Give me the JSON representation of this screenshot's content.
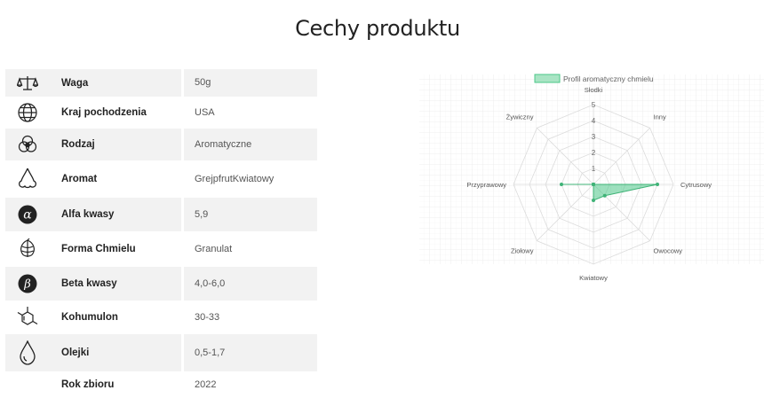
{
  "page": {
    "title": "Cechy produktu"
  },
  "properties": [
    {
      "icon": "scale-icon",
      "label": "Waga",
      "values": [
        "50g"
      ]
    },
    {
      "icon": "globe-icon",
      "label": "Kraj pochodzenia",
      "values": [
        "USA"
      ]
    },
    {
      "icon": "hop-flower-icon",
      "label": "Rodzaj",
      "values": [
        "Aromatyczne"
      ]
    },
    {
      "icon": "nose-icon",
      "label": "Aromat",
      "values": [
        "Grejpfrut",
        "Kwiatowy"
      ]
    },
    {
      "icon": "alpha-icon",
      "label": "Alfa kwasy",
      "values": [
        "5,9"
      ]
    },
    {
      "icon": "hop-cone-icon",
      "label": "Forma Chmielu",
      "values": [
        "Granulat"
      ]
    },
    {
      "icon": "beta-icon",
      "label": "Beta kwasy",
      "values": [
        "4,0-6,0"
      ]
    },
    {
      "icon": "molecule-icon",
      "label": "Kohumulon",
      "values": [
        "30-33"
      ]
    },
    {
      "icon": "drop-icon",
      "label": "Olejki",
      "values": [
        "0,5-1,7"
      ]
    },
    {
      "icon": "",
      "label": "Rok zbioru",
      "values": [
        "2022"
      ]
    }
  ],
  "chart_data": {
    "type": "radar",
    "legend": "Profil aromatyczny chmielu",
    "legend_position": "top",
    "categories": [
      "Słodki",
      "Inny",
      "Cytrusowy",
      "Owocowy",
      "Kwiatowy",
      "Ziołowy",
      "Przyprawowy",
      "Żywiczny"
    ],
    "series": [
      {
        "name": "Profil aromatyczny chmielu",
        "values": [
          0,
          0,
          4,
          1,
          1,
          0,
          2,
          0
        ]
      }
    ],
    "scale_min": 0,
    "scale_max": 5,
    "ticks": [
      "1",
      "2",
      "3",
      "4",
      "5"
    ],
    "colors": {
      "fill": "#4cc788",
      "stroke": "#3fb377",
      "grid": "#dcdcdc"
    }
  }
}
